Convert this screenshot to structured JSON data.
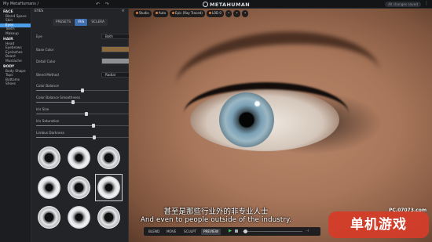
{
  "topbar": {
    "breadcrumb": "My MetaHumans /",
    "brand": "METAHUMAN",
    "saved": "All changes saved",
    "menu": "⋮"
  },
  "leftnav": {
    "sections": [
      {
        "title": "FACE",
        "items": [
          "Blend Space",
          "Skin",
          "Eyes",
          "Teeth",
          "Makeup"
        ],
        "active": "Eyes"
      },
      {
        "title": "HAIR",
        "items": [
          "Head",
          "Eyebrows",
          "Eyelashes",
          "Beard",
          "Mustache"
        ]
      },
      {
        "title": "BODY",
        "items": [
          "Body Shape",
          "Tops",
          "Bottoms",
          "Shoes"
        ]
      }
    ]
  },
  "panel": {
    "title": "EYES",
    "tabs": [
      "PRESETS",
      "IRIS",
      "SCLERA"
    ],
    "active_tab": "IRIS",
    "eye_label": "Eye",
    "eye_value": "Both",
    "base_color_label": "Base Color",
    "base_color": "#8c6a3f",
    "detail_color_label": "Detail Color",
    "detail_color": "#8e9093",
    "blend_method_label": "Blend Method",
    "blend_method_value": "Radial",
    "sliders": [
      {
        "label": "Color Balance",
        "value": "0.50",
        "level": 0.5
      },
      {
        "label": "Color Balance Smoothness",
        "value": "0.40",
        "level": 0.4
      },
      {
        "label": "Iris Size",
        "value": "0.54",
        "level": 0.54
      },
      {
        "label": "Iris Saturation",
        "value": "0.70",
        "level": 0.62
      },
      {
        "label": "Limbus Darkness",
        "value": "0.63",
        "level": 0.63
      }
    ],
    "iris_presets_count": 9,
    "selected_iris_index": 5
  },
  "viewport": {
    "toolbar": [
      "Studio",
      "Auto",
      "Epic (Ray Traced)",
      "LOD 0"
    ],
    "colors": {
      "skin": "#a8765a",
      "iris": "#7aa0b5"
    }
  },
  "subtitles": {
    "zh": "甚至是那些行业外的非专业人士",
    "en": "And even to people outside of the industry."
  },
  "modebar": {
    "modes": [
      "BLEND",
      "MOVE",
      "SCULPT",
      "PREVIEW"
    ],
    "active": "PREVIEW"
  },
  "watermark": {
    "url": "PC.07073.com",
    "logo": "单机游戏"
  }
}
